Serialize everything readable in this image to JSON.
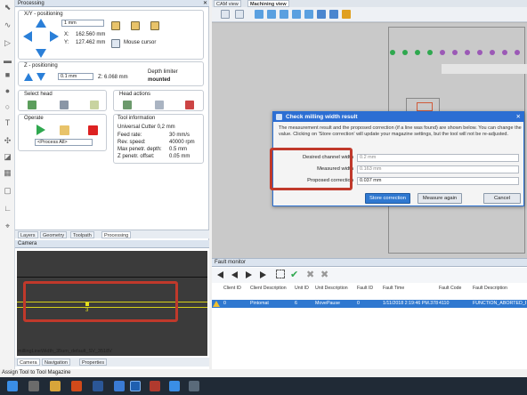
{
  "processing": {
    "title": "Processing",
    "xy_label": "X/Y - positioning",
    "step_value": "1 mm",
    "x_label": "X:",
    "x_value": "162.560 mm",
    "y_label": "Y:",
    "y_value": "127.462 mm",
    "mouse_cursor": "Mouse cursor",
    "z_label": "Z - positioning",
    "z_step": "0.1 mm",
    "z_readout_label": "Z:",
    "z_value": "6.068 mm",
    "depth_limiter": "Depth limiter",
    "depth_status": "mounted",
    "select_head": "Select head",
    "head_actions": "Head actions",
    "operate": "Operate",
    "process_select": "<Process All>",
    "tool_info_label": "Tool information",
    "tool_name": "Universal Cutter 0,2 mm",
    "tool_rows": [
      {
        "k": "Feed rate:",
        "v": "30 mm/s"
      },
      {
        "k": "Rev. speed:",
        "v": "40000 rpm"
      },
      {
        "k": "Max penetr. depth:",
        "v": "0.5 mm"
      },
      {
        "k": "Z penetr. offset:",
        "v": "0.05 mm"
      }
    ]
  },
  "bottom_tabs": [
    "Layers",
    "Geometry",
    "Toolpath",
    "Processing"
  ],
  "camera": {
    "title": "Camera",
    "caption": "millingLineWidth_35um_default_SV_3518V",
    "tabs": [
      "Camera",
      "Navigation",
      "Properties"
    ],
    "marker": "3"
  },
  "view_tabs": [
    "CAM view",
    "Machining view"
  ],
  "dialog": {
    "title": "Check milling width result",
    "message": "The measurement result and the proposed correction (if a line was found) are shown below. You can change the value. Clicking on 'Store correction' will update your magazine settings, but the tool will not be re-adjusted.",
    "rows": [
      {
        "label": "Desired channel width",
        "value": "0.2 mm"
      },
      {
        "label": "Measured width",
        "value": "0.163 mm"
      },
      {
        "label": "Proposed correction",
        "value": "0.037 mm"
      }
    ],
    "store_btn": "Store correction",
    "measure_btn": "Measure again",
    "cancel_btn": "Cancel"
  },
  "fault": {
    "title": "Fault monitor",
    "headers": [
      "Client ID",
      "Client Description",
      "Unit ID",
      "Unit Description",
      "Fault ID",
      "Fault Time",
      "Fault Code",
      "Fault Description"
    ],
    "row": [
      "0",
      "Pintomat",
      "6",
      "MovePause",
      "0",
      "1/11/2018 2:19:46 PM.378",
      "4110",
      "FUNCTION_ABORTED_BY"
    ]
  },
  "status_text": "Assign Tool to Tool Magazine",
  "colors": {
    "accent": "#2c6ed3",
    "highlight": "#c0392b",
    "selection": "#2f78d0"
  }
}
